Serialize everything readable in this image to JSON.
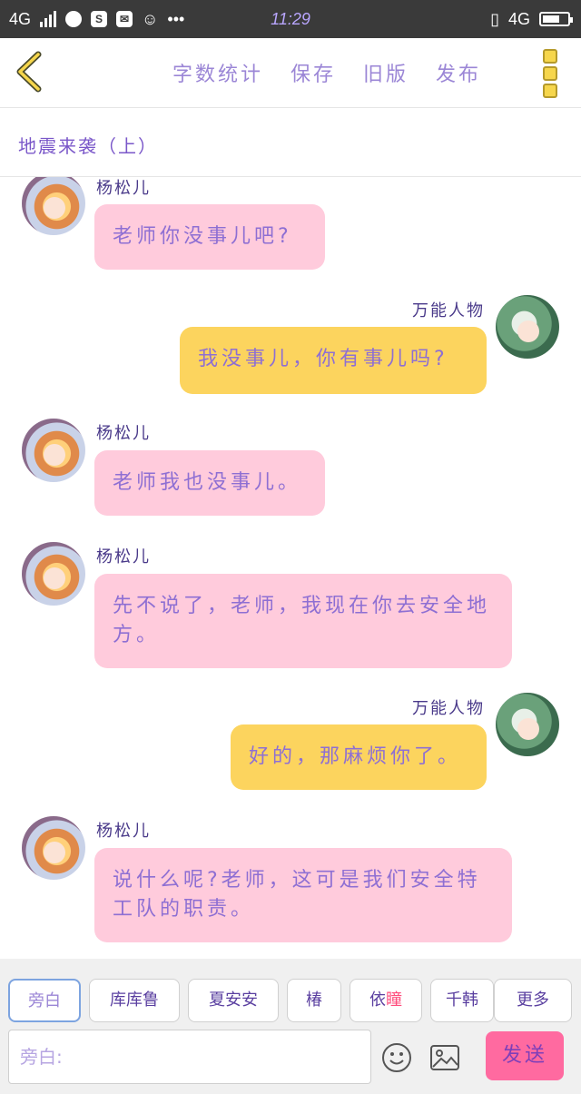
{
  "status_bar": {
    "network_left": "4G",
    "time": "11:29",
    "network_right": "4G"
  },
  "toolbar": {
    "back_icon": "chevron-left-icon",
    "items": [
      "字数统计",
      "保存",
      "旧版",
      "发布"
    ],
    "more_icon": "more-vertical-icon"
  },
  "title": "地震来袭（上）",
  "messages": [
    {
      "side": "left",
      "sender": "杨松儿",
      "text": "老师你没事儿吧?"
    },
    {
      "side": "right",
      "sender": "万能人物",
      "text": "我没事儿，你有事儿吗?"
    },
    {
      "side": "left",
      "sender": "杨松儿",
      "text": "老师我也没事儿。"
    },
    {
      "side": "left",
      "sender": "杨松儿",
      "text": "先不说了，老师，我现在你去安全地方。"
    },
    {
      "side": "right",
      "sender": "万能人物",
      "text": "好的，那麻烦你了。"
    },
    {
      "side": "left",
      "sender": "杨松儿",
      "text": "说什么呢?老师，这可是我们安全特工队的职责。"
    }
  ],
  "characters": [
    {
      "label": "旁白"
    },
    {
      "label": "库库鲁"
    },
    {
      "label": "夏安安"
    },
    {
      "label": "椿"
    },
    {
      "label_pre": "依",
      "label_hl": "瞳"
    },
    {
      "label": "千韩"
    },
    {
      "label": "更多"
    }
  ],
  "composer": {
    "placeholder": "旁白:",
    "emoji_icon": "smiley-icon",
    "image_icon": "image-icon",
    "send_label": "发送"
  },
  "colors": {
    "accent_purple": "#9b86d6",
    "left_bubble": "#ffcbdc",
    "right_bubble": "#fcd45e",
    "send_button": "#ff6aa0"
  }
}
